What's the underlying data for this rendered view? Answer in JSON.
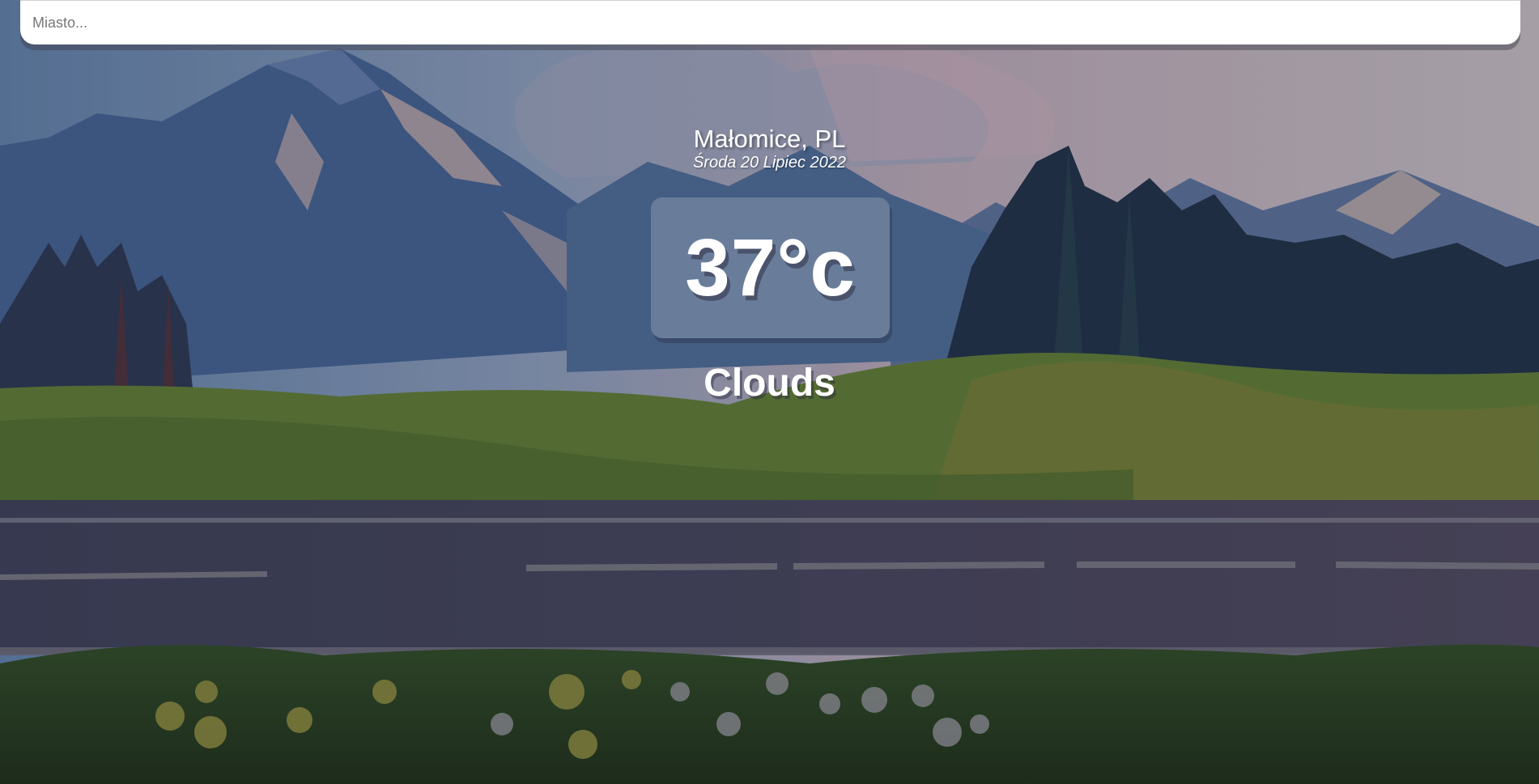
{
  "search": {
    "placeholder": "Miasto...",
    "value": ""
  },
  "location": "Małomice, PL",
  "date": "Środa 20 Lipiec 2022",
  "temperature": "37°c",
  "weather": "Clouds"
}
